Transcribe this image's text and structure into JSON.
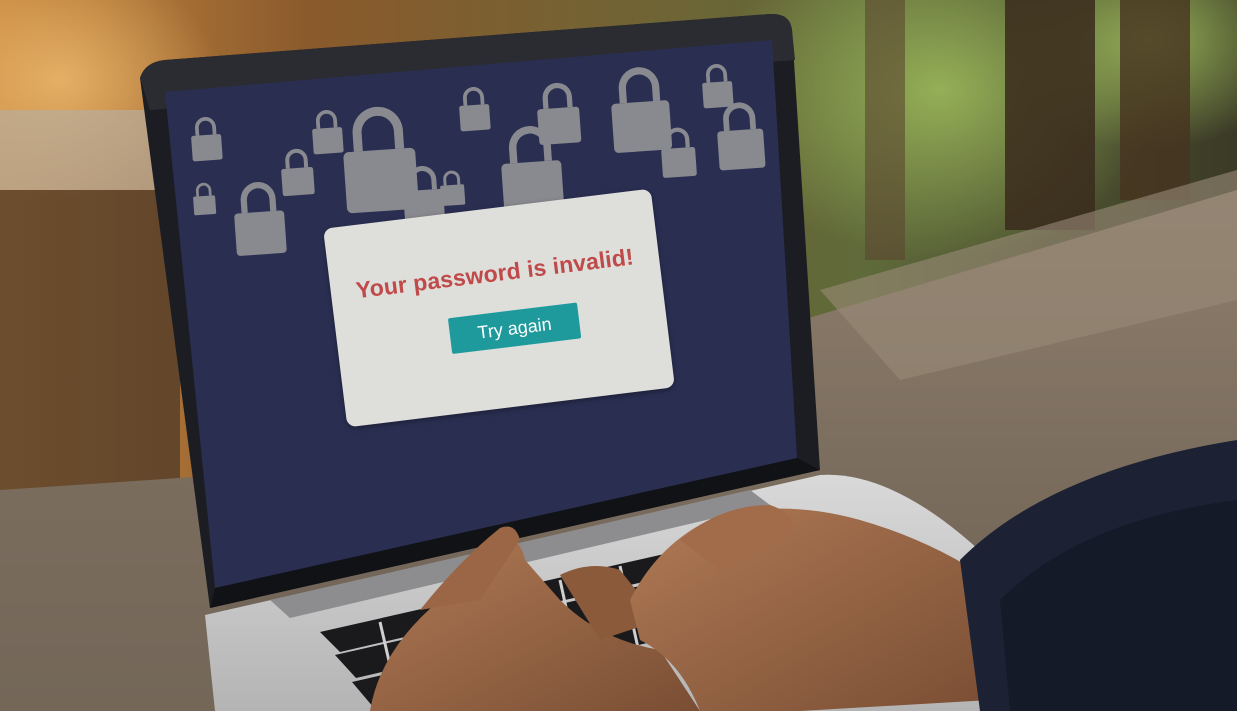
{
  "dialog": {
    "message": "Your password is invalid!",
    "button_label": "Try again"
  },
  "colors": {
    "screen_background": "#2a2f52",
    "dialog_background": "#dededb",
    "message_text": "#c04a4a",
    "button_background": "#1f9a9c",
    "lock_icon": "#8f8f93"
  },
  "lock_icons": [
    "padlock-icon",
    "padlock-icon",
    "padlock-icon",
    "padlock-icon",
    "padlock-icon",
    "padlock-icon",
    "padlock-icon",
    "padlock-icon",
    "padlock-icon",
    "padlock-icon",
    "padlock-icon",
    "padlock-icon",
    "padlock-icon",
    "padlock-icon",
    "padlock-icon",
    "padlock-icon"
  ]
}
